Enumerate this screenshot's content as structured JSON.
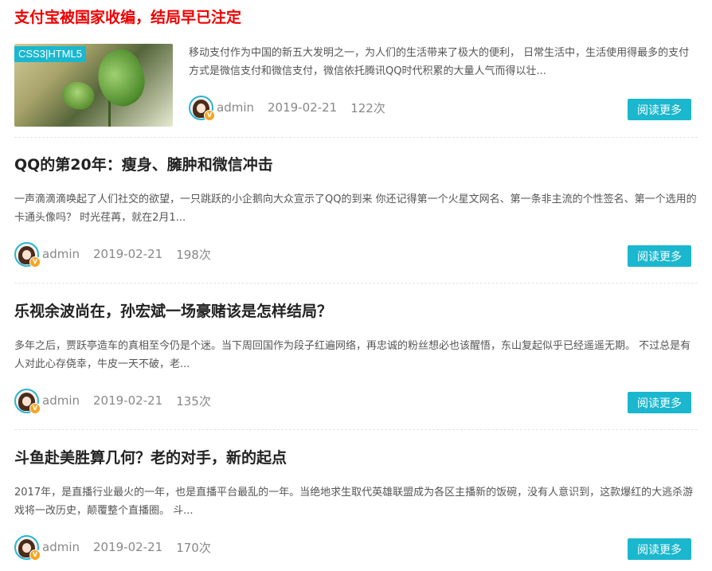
{
  "articles": [
    {
      "title": "支付宝被国家收编，结局早已注定",
      "thumbnail_tag": "CSS3|HTML5",
      "summary": "移动支付作为中国的新五大发明之一，为人们的生活带来了极大的便利， 日常生活中，生活使用得最多的支付方式是微信支付和微信支付，微信依托腾讯QQ时代积累的大量人气而得以壮...",
      "author": "admin",
      "date": "2019-02-21",
      "views": "122次",
      "read_more": "阅读更多"
    },
    {
      "title": "QQ的第20年：瘦身、臃肿和微信冲击",
      "summary": "一声滴滴滴唤起了人们社交的欲望，一只跳跃的小企鹅向大众宣示了QQ的到来 你还记得第一个火星文网名、第一条非主流的个性签名、第一个选用的卡通头像吗？ 时光荏苒，就在2月1...",
      "author": "admin",
      "date": "2019-02-21",
      "views": "198次",
      "read_more": "阅读更多"
    },
    {
      "title": "乐视余波尚在，孙宏斌一场豪赌该是怎样结局？",
      "summary": "多年之后，贾跃亭造车的真相至今仍是个迷。当下周回国作为段子红遍网络，再忠诚的粉丝想必也该醒悟，东山复起似乎已经遥遥无期。 不过总是有人对此心存侥幸，牛皮一天不破，老...",
      "author": "admin",
      "date": "2019-02-21",
      "views": "135次",
      "read_more": "阅读更多"
    },
    {
      "title": "斗鱼赴美胜算几何？老的对手，新的起点",
      "summary": "2017年，是直播行业最火的一年，也是直播平台最乱的一年。当绝地求生取代英雄联盟成为各区主播新的饭碗，没有人意识到，这款爆红的大逃杀游戏将一改历史，颠覆整个直播圈。 斗...",
      "author": "admin",
      "date": "2019-02-21",
      "views": "170次",
      "read_more": "阅读更多"
    }
  ],
  "colors": {
    "accent": "#1ab7ce",
    "featured_title": "#ee0000",
    "badge": "#f5a623"
  }
}
